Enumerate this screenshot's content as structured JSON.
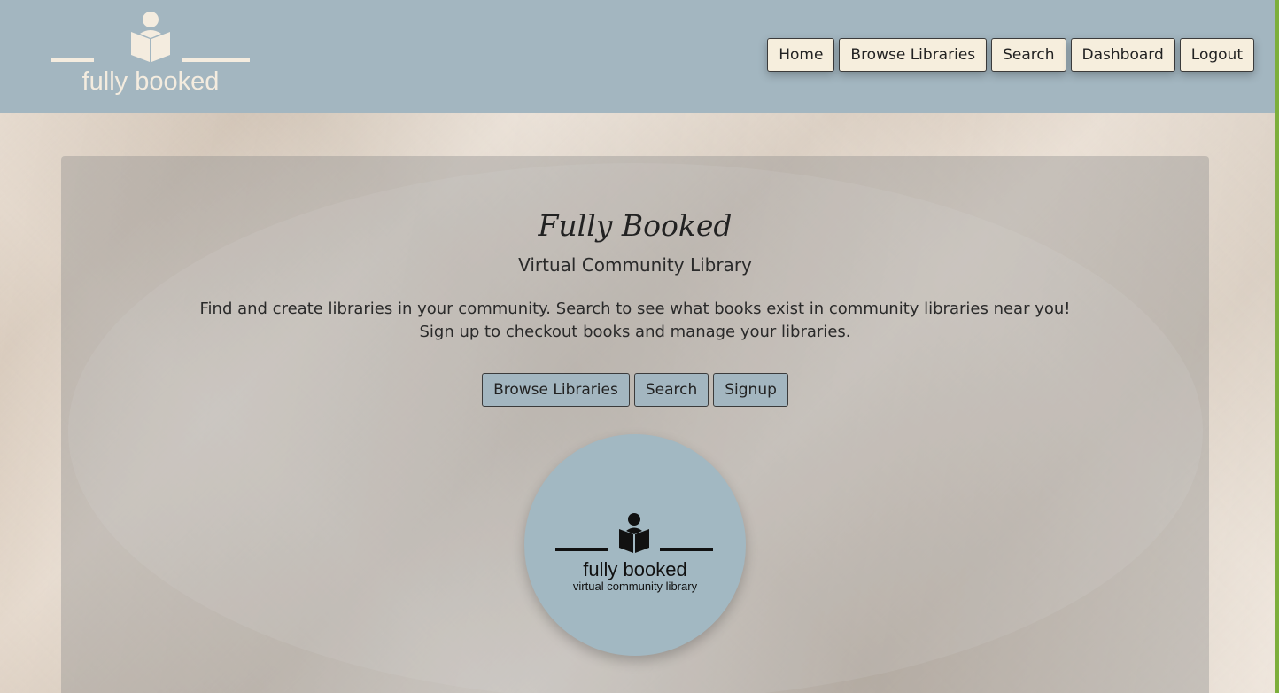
{
  "header": {
    "brand_name": "fully booked",
    "nav": [
      {
        "label": "Home"
      },
      {
        "label": "Browse Libraries"
      },
      {
        "label": "Search"
      },
      {
        "label": "Dashboard"
      },
      {
        "label": "Logout"
      }
    ]
  },
  "hero": {
    "title": "Fully Booked",
    "subtitle": "Virtual Community Library",
    "description_line1": "Find and create libraries in your community. Search to see what books exist in community libraries near you!",
    "description_line2": "Sign up to checkout books and manage your libraries.",
    "actions": [
      {
        "label": "Browse Libraries"
      },
      {
        "label": "Search"
      },
      {
        "label": "Signup"
      }
    ]
  },
  "logo": {
    "name": "fully booked",
    "tagline": "virtual community library",
    "icon": "reader-book-icon"
  },
  "colors": {
    "header_bg": "#a3b6c0",
    "nav_button_bg": "#f6eedd",
    "hero_button_bg": "#a3b6c0",
    "logo_circle_bg": "#a2b8c2",
    "brand_text": "#f4ecdf",
    "accent_edge": "#7cae3b"
  }
}
